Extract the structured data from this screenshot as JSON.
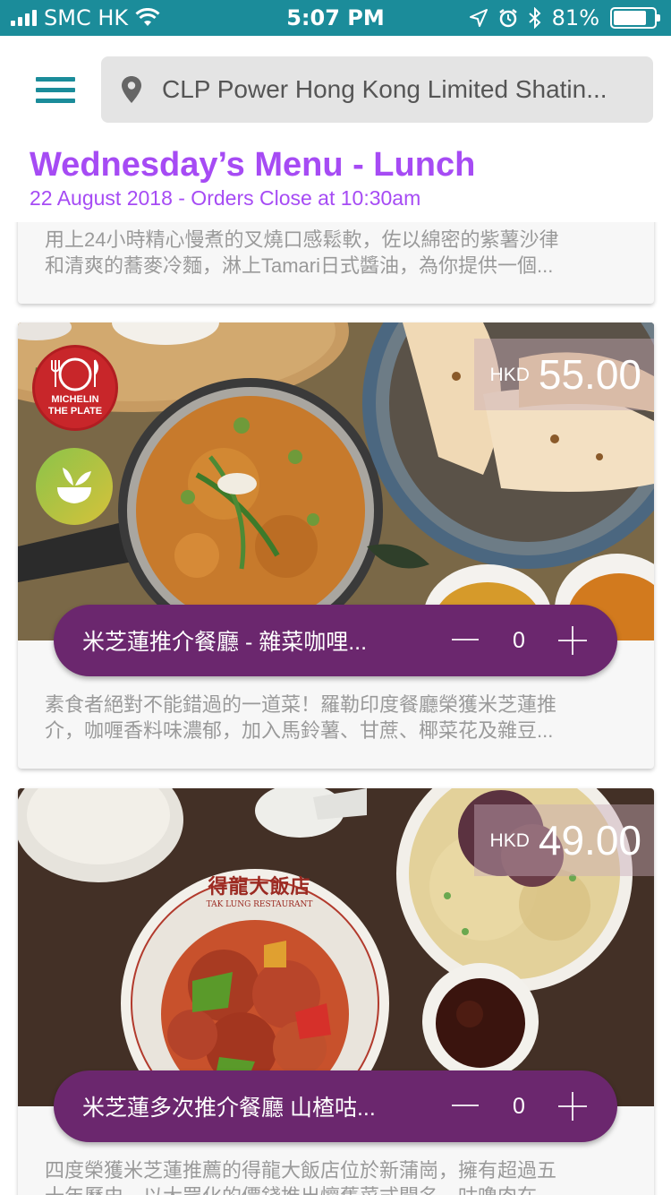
{
  "status_bar": {
    "carrier": "SMC HK",
    "time": "5:07 PM",
    "battery": "81%",
    "battery_level": 0.81
  },
  "header": {
    "menu_icon": "hamburger-icon",
    "location_icon": "location-pin-icon",
    "location": "CLP Power Hong Kong Limited Shatin..."
  },
  "menu": {
    "title": "Wednesday’s Menu - Lunch",
    "subtitle": "22 August 2018 - Orders Close at 10:30am"
  },
  "items": [
    {
      "description_line1": "用上24小時精心慢煮的叉燒口感鬆軟，佐以綿密的紫薯沙律",
      "description_line2": "和清爽的蕎麥冷麵，淋上Tamari日式醬油，為你提供一個..."
    },
    {
      "currency": "HKD",
      "price": "55.00",
      "badge_michelin_line1": "MICHELIN",
      "badge_michelin_line2": "THE PLATE",
      "badge_veg_icon": "vegetarian-bowl-icon",
      "name": "米芝蓮推介餐廳 - 雜菜咖哩...",
      "quantity": "0",
      "description_line1": "素食者絕對不能錯過的一道菜！羅勒印度餐廳榮獲米芝蓮推",
      "description_line2": "介，咖喱香料味濃郁，加入馬鈴薯、甘蔗、椰菜花及雜豆..."
    },
    {
      "currency": "HKD",
      "price": "49.00",
      "plate_text": "得龍大飯店",
      "plate_subtext": "TAK LUNG RESTAURANT",
      "name": "米芝蓮多次推介餐廳 山楂咕...",
      "quantity": "0",
      "description_line1": "四度榮獲米芝蓮推薦的得龍大飯店位於新蒲崗，擁有超過五",
      "description_line2": "十年歷史，以大眾化的價錢推出懷舊菜式聞名。咕嚕肉在..."
    }
  ],
  "colors": {
    "teal": "#1b8c9a",
    "purple_title": "#a64bf4",
    "order_bar": "#6b276e"
  }
}
